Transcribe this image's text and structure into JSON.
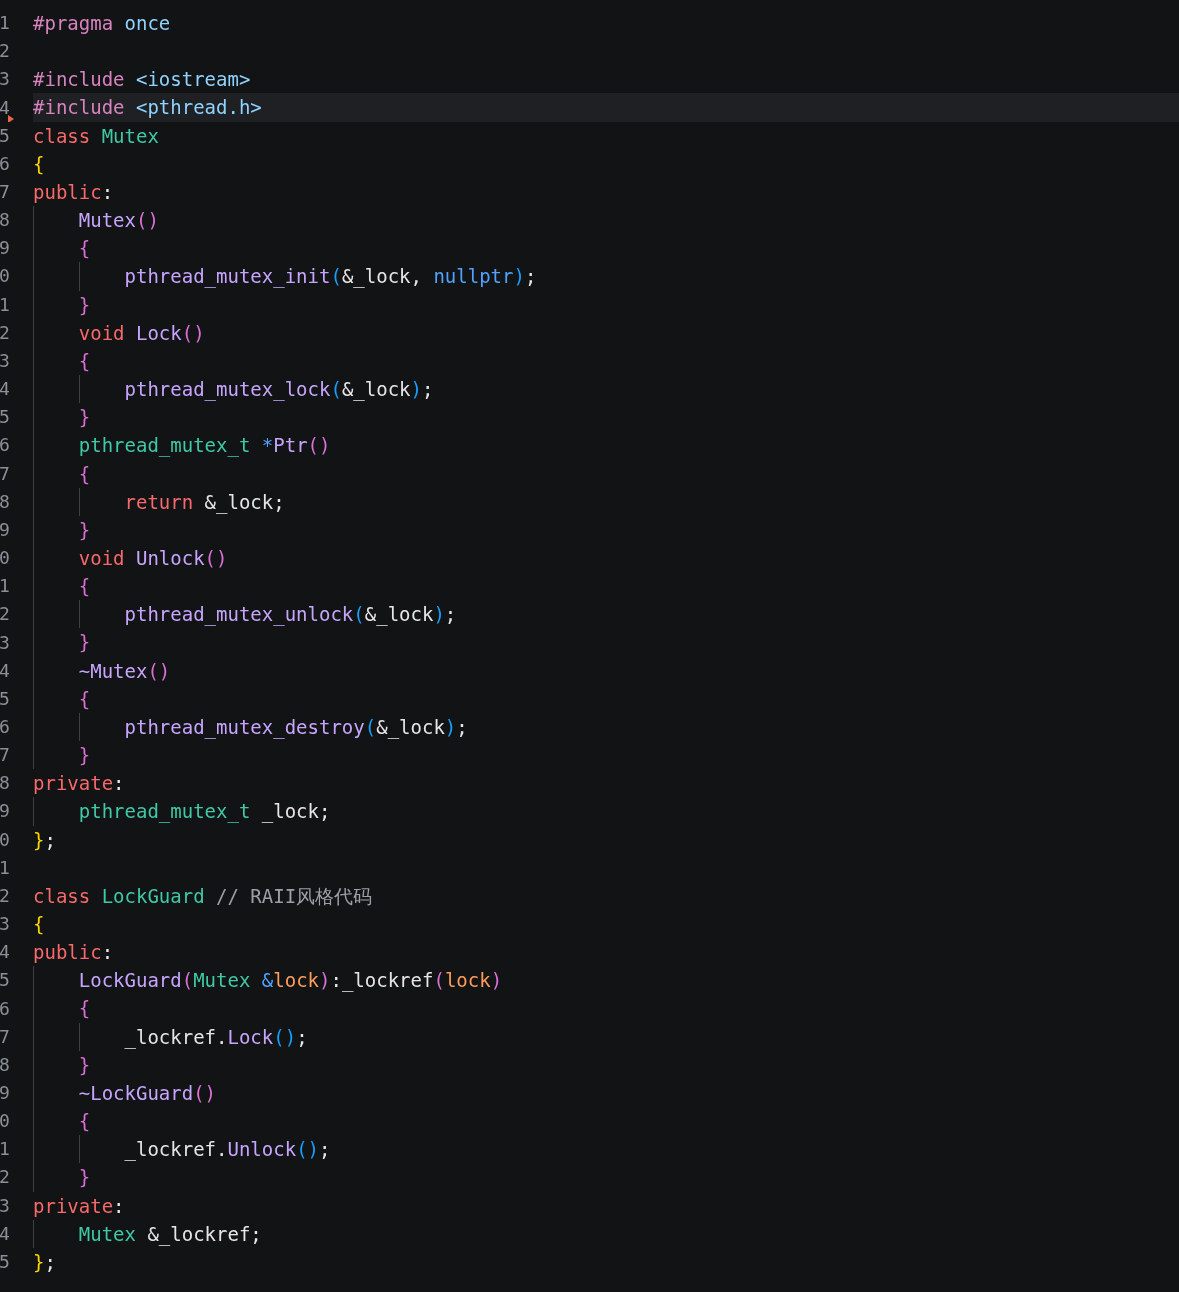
{
  "editor": {
    "lines": [
      {
        "number": "1",
        "tokens": [
          {
            "kind": "preproc",
            "text": "#pragma"
          },
          {
            "kind": "path",
            "text": " once"
          }
        ]
      },
      {
        "number": "2"
      },
      {
        "number": "3",
        "tokens": [
          {
            "kind": "preproc",
            "text": "#include"
          },
          {
            "kind": "path",
            "text": " <iostream>"
          }
        ]
      },
      {
        "number": "4",
        "current": true,
        "marker": true,
        "tokens": [
          {
            "kind": "preproc",
            "text": "#include"
          },
          {
            "kind": "path",
            "text": " <pthread.h>"
          }
        ]
      },
      {
        "number": "5",
        "tokens": [
          {
            "kind": "keyword",
            "text": "class"
          },
          {
            "kind": "type",
            "text": " Mutex"
          }
        ]
      },
      {
        "number": "6",
        "tokens": [
          {
            "kind": "brace0",
            "text": "{"
          }
        ]
      },
      {
        "number": "7",
        "tokens": [
          {
            "kind": "keyword",
            "text": "public"
          },
          {
            "kind": "plain",
            "text": ":"
          }
        ]
      },
      {
        "number": "8",
        "tokens": [
          {
            "kind": "function",
            "text": "    Mutex"
          },
          {
            "kind": "paren1",
            "text": "()"
          }
        ]
      },
      {
        "number": "9",
        "tokens": [
          {
            "kind": "paren1",
            "text": "    {"
          }
        ]
      },
      {
        "number": "0",
        "tokens": [
          {
            "kind": "function",
            "text": "        pthread_mutex_init"
          },
          {
            "kind": "paren2",
            "text": "("
          },
          {
            "kind": "plain",
            "text": "&_lock, "
          },
          {
            "kind": "constant",
            "text": "nullptr"
          },
          {
            "kind": "paren2",
            "text": ")"
          },
          {
            "kind": "plain",
            "text": ";"
          }
        ]
      },
      {
        "number": "1",
        "tokens": [
          {
            "kind": "paren1",
            "text": "    }"
          }
        ]
      },
      {
        "number": "2",
        "tokens": [
          {
            "kind": "keyword",
            "text": "    void"
          },
          {
            "kind": "function",
            "text": " Lock"
          },
          {
            "kind": "paren1",
            "text": "()"
          }
        ]
      },
      {
        "number": "3",
        "tokens": [
          {
            "kind": "paren1",
            "text": "    {"
          }
        ]
      },
      {
        "number": "4",
        "tokens": [
          {
            "kind": "function",
            "text": "        pthread_mutex_lock"
          },
          {
            "kind": "paren2",
            "text": "("
          },
          {
            "kind": "plain",
            "text": "&_lock"
          },
          {
            "kind": "paren2",
            "text": ")"
          },
          {
            "kind": "plain",
            "text": ";"
          }
        ]
      },
      {
        "number": "5",
        "tokens": [
          {
            "kind": "paren1",
            "text": "    }"
          }
        ]
      },
      {
        "number": "6",
        "tokens": [
          {
            "kind": "type",
            "text": "    pthread_mutex_t"
          },
          {
            "kind": "constant",
            "text": " *"
          },
          {
            "kind": "function",
            "text": "Ptr"
          },
          {
            "kind": "paren1",
            "text": "()"
          }
        ]
      },
      {
        "number": "7",
        "tokens": [
          {
            "kind": "paren1",
            "text": "    {"
          }
        ]
      },
      {
        "number": "8",
        "tokens": [
          {
            "kind": "keyword",
            "text": "        return"
          },
          {
            "kind": "plain",
            "text": " &_lock;"
          }
        ]
      },
      {
        "number": "9",
        "tokens": [
          {
            "kind": "paren1",
            "text": "    }"
          }
        ]
      },
      {
        "number": "0",
        "tokens": [
          {
            "kind": "keyword",
            "text": "    void"
          },
          {
            "kind": "function",
            "text": " Unlock"
          },
          {
            "kind": "paren1",
            "text": "()"
          }
        ]
      },
      {
        "number": "1",
        "tokens": [
          {
            "kind": "paren1",
            "text": "    {"
          }
        ]
      },
      {
        "number": "2",
        "tokens": [
          {
            "kind": "function",
            "text": "        pthread_mutex_unlock"
          },
          {
            "kind": "paren2",
            "text": "("
          },
          {
            "kind": "plain",
            "text": "&_lock"
          },
          {
            "kind": "paren2",
            "text": ")"
          },
          {
            "kind": "plain",
            "text": ";"
          }
        ]
      },
      {
        "number": "3",
        "tokens": [
          {
            "kind": "paren1",
            "text": "    }"
          }
        ]
      },
      {
        "number": "4",
        "tokens": [
          {
            "kind": "function",
            "text": "    ~Mutex"
          },
          {
            "kind": "paren1",
            "text": "()"
          }
        ]
      },
      {
        "number": "5",
        "tokens": [
          {
            "kind": "paren1",
            "text": "    {"
          }
        ]
      },
      {
        "number": "6",
        "tokens": [
          {
            "kind": "function",
            "text": "        pthread_mutex_destroy"
          },
          {
            "kind": "paren2",
            "text": "("
          },
          {
            "kind": "plain",
            "text": "&_lock"
          },
          {
            "kind": "paren2",
            "text": ")"
          },
          {
            "kind": "plain",
            "text": ";"
          }
        ]
      },
      {
        "number": "7",
        "tokens": [
          {
            "kind": "paren1",
            "text": "    }"
          }
        ]
      },
      {
        "number": "8",
        "tokens": [
          {
            "kind": "keyword",
            "text": "private"
          },
          {
            "kind": "plain",
            "text": ":"
          }
        ]
      },
      {
        "number": "9",
        "tokens": [
          {
            "kind": "type",
            "text": "    pthread_mutex_t"
          },
          {
            "kind": "plain",
            "text": " _lock;"
          }
        ]
      },
      {
        "number": "0",
        "tokens": [
          {
            "kind": "brace0",
            "text": "}"
          },
          {
            "kind": "plain",
            "text": ";"
          }
        ]
      },
      {
        "number": "1"
      },
      {
        "number": "2",
        "tokens": [
          {
            "kind": "keyword",
            "text": "class"
          },
          {
            "kind": "type",
            "text": " LockGuard"
          },
          {
            "kind": "comment",
            "text": " // RAII风格代码"
          }
        ]
      },
      {
        "number": "3",
        "tokens": [
          {
            "kind": "brace0",
            "text": "{"
          }
        ]
      },
      {
        "number": "4",
        "tokens": [
          {
            "kind": "keyword",
            "text": "public"
          },
          {
            "kind": "plain",
            "text": ":"
          }
        ]
      },
      {
        "number": "5",
        "tokens": [
          {
            "kind": "function",
            "text": "    LockGuard"
          },
          {
            "kind": "paren1",
            "text": "("
          },
          {
            "kind": "type",
            "text": "Mutex"
          },
          {
            "kind": "constant",
            "text": " &"
          },
          {
            "kind": "param",
            "text": "lock"
          },
          {
            "kind": "paren1",
            "text": ")"
          },
          {
            "kind": "plain",
            "text": ":_lockref"
          },
          {
            "kind": "paren1",
            "text": "("
          },
          {
            "kind": "param",
            "text": "lock"
          },
          {
            "kind": "paren1",
            "text": ")"
          }
        ]
      },
      {
        "number": "6",
        "tokens": [
          {
            "kind": "paren1",
            "text": "    {"
          }
        ]
      },
      {
        "number": "7",
        "tokens": [
          {
            "kind": "plain",
            "text": "        _lockref."
          },
          {
            "kind": "function",
            "text": "Lock"
          },
          {
            "kind": "paren2",
            "text": "()"
          },
          {
            "kind": "plain",
            "text": ";"
          }
        ]
      },
      {
        "number": "8",
        "tokens": [
          {
            "kind": "paren1",
            "text": "    }"
          }
        ]
      },
      {
        "number": "9",
        "tokens": [
          {
            "kind": "function",
            "text": "    ~LockGuard"
          },
          {
            "kind": "paren1",
            "text": "()"
          }
        ]
      },
      {
        "number": "0",
        "tokens": [
          {
            "kind": "paren1",
            "text": "    {"
          }
        ]
      },
      {
        "number": "1",
        "tokens": [
          {
            "kind": "plain",
            "text": "        _lockref."
          },
          {
            "kind": "function",
            "text": "Unlock"
          },
          {
            "kind": "paren2",
            "text": "()"
          },
          {
            "kind": "plain",
            "text": ";"
          }
        ]
      },
      {
        "number": "2",
        "tokens": [
          {
            "kind": "paren1",
            "text": "    }"
          }
        ]
      },
      {
        "number": "3",
        "tokens": [
          {
            "kind": "keyword",
            "text": "private"
          },
          {
            "kind": "plain",
            "text": ":"
          }
        ]
      },
      {
        "number": "4",
        "tokens": [
          {
            "kind": "type",
            "text": "    Mutex"
          },
          {
            "kind": "plain",
            "text": " &_lockref;"
          }
        ]
      },
      {
        "number": "5",
        "tokens": [
          {
            "kind": "brace0",
            "text": "}"
          },
          {
            "kind": "plain",
            "text": ";"
          }
        ]
      }
    ]
  }
}
